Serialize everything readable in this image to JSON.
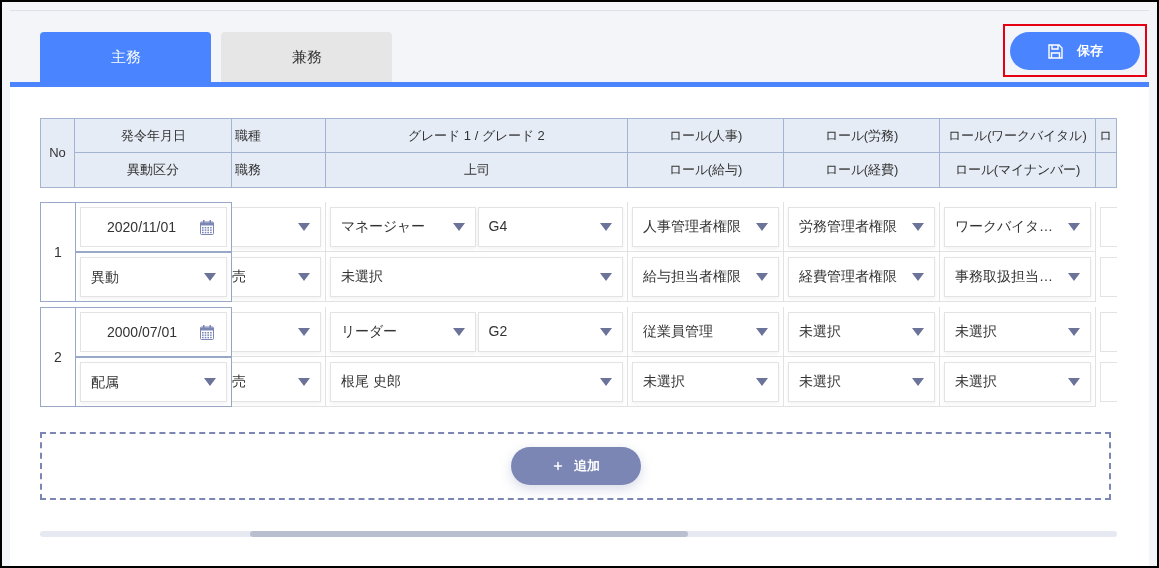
{
  "tabs": [
    {
      "label": "主務",
      "selected": true
    },
    {
      "label": "兼務",
      "selected": false
    }
  ],
  "save_button": "保存",
  "header": {
    "no": "No",
    "columns": [
      {
        "top": "発令年月日",
        "bottom": "異動区分"
      },
      {
        "top": "職種",
        "bottom": "職務"
      },
      {
        "top": "グレード 1 / グレード 2",
        "bottom": "上司"
      },
      {
        "top": "ロール(人事)",
        "bottom": "ロール(給与)"
      },
      {
        "top": "ロール(労務)",
        "bottom": "ロール(経費)"
      },
      {
        "top": "ロール(ワークバイタル)",
        "bottom": "ロール(マイナンバー)"
      },
      {
        "top": "ロ"
      }
    ]
  },
  "records": [
    {
      "no": "1",
      "date": "2020/11/01",
      "transfer_type": "異動",
      "duty": "売",
      "grade_1": "マネージャー",
      "grade_2": "G4",
      "boss": "未選択",
      "role_hr": "人事管理者権限",
      "role_payroll": "給与担当者権限",
      "role_labor": "労務管理者権限",
      "role_expense": "経費管理者権限",
      "role_work_vital": "ワークバイタ…",
      "role_my_number": "事務取扱担当…"
    },
    {
      "no": "2",
      "date": "2000/07/01",
      "transfer_type": "配属",
      "duty": "売",
      "grade_1": "リーダー",
      "grade_2": "G2",
      "boss": "根尾 史郎",
      "role_hr": "従業員管理",
      "role_payroll": "未選択",
      "role_labor": "未選択",
      "role_expense": "未選択",
      "role_work_vital": "未選択",
      "role_my_number": "未選択"
    }
  ],
  "add_button": "追加"
}
